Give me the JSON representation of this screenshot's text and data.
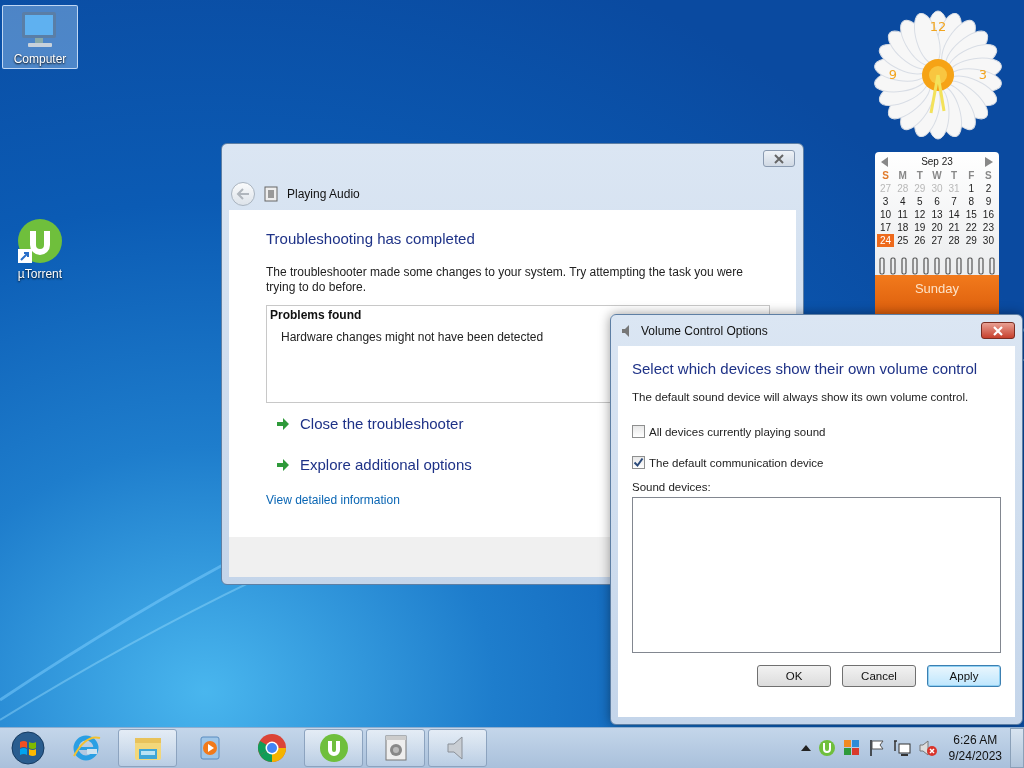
{
  "desktop_icons": [
    {
      "kind": "computer",
      "label": "Computer",
      "selected": true
    },
    {
      "kind": "torrent",
      "label": "µTorrent",
      "selected": false
    }
  ],
  "clock_gadget": {
    "numerals": [
      "12",
      "9",
      "3"
    ]
  },
  "calendar_gadget": {
    "month": "Sep 23",
    "weekdays": [
      {
        "label": "S",
        "current": true
      },
      {
        "label": "M",
        "current": false
      },
      {
        "label": "T",
        "current": false
      },
      {
        "label": "W",
        "current": false
      },
      {
        "label": "T",
        "current": false
      },
      {
        "label": "F",
        "current": false
      },
      {
        "label": "S",
        "current": false
      }
    ],
    "weeks": [
      [
        {
          "day": "27",
          "other_month": true,
          "selected": false
        },
        {
          "day": "28",
          "other_month": true,
          "selected": false
        },
        {
          "day": "29",
          "other_month": true,
          "selected": false
        },
        {
          "day": "30",
          "other_month": true,
          "selected": false
        },
        {
          "day": "31",
          "other_month": true,
          "selected": false
        },
        {
          "day": "1",
          "other_month": false,
          "selected": false
        },
        {
          "day": "2",
          "other_month": false,
          "selected": false
        }
      ],
      [
        {
          "day": "3",
          "other_month": false,
          "selected": false
        },
        {
          "day": "4",
          "other_month": false,
          "selected": false
        },
        {
          "day": "5",
          "other_month": false,
          "selected": false
        },
        {
          "day": "6",
          "other_month": false,
          "selected": false
        },
        {
          "day": "7",
          "other_month": false,
          "selected": false
        },
        {
          "day": "8",
          "other_month": false,
          "selected": false
        },
        {
          "day": "9",
          "other_month": false,
          "selected": false
        }
      ],
      [
        {
          "day": "10",
          "other_month": false,
          "selected": false
        },
        {
          "day": "11",
          "other_month": false,
          "selected": false
        },
        {
          "day": "12",
          "other_month": false,
          "selected": false
        },
        {
          "day": "13",
          "other_month": false,
          "selected": false
        },
        {
          "day": "14",
          "other_month": false,
          "selected": false
        },
        {
          "day": "15",
          "other_month": false,
          "selected": false
        },
        {
          "day": "16",
          "other_month": false,
          "selected": false
        }
      ],
      [
        {
          "day": "17",
          "other_month": false,
          "selected": false
        },
        {
          "day": "18",
          "other_month": false,
          "selected": false
        },
        {
          "day": "19",
          "other_month": false,
          "selected": false
        },
        {
          "day": "20",
          "other_month": false,
          "selected": false
        },
        {
          "day": "21",
          "other_month": false,
          "selected": false
        },
        {
          "day": "22",
          "other_month": false,
          "selected": false
        },
        {
          "day": "23",
          "other_month": false,
          "selected": false
        }
      ],
      [
        {
          "day": "24",
          "other_month": false,
          "selected": true
        },
        {
          "day": "25",
          "other_month": false,
          "selected": false
        },
        {
          "day": "26",
          "other_month": false,
          "selected": false
        },
        {
          "day": "27",
          "other_month": false,
          "selected": false
        },
        {
          "day": "28",
          "other_month": false,
          "selected": false
        },
        {
          "day": "29",
          "other_month": false,
          "selected": false
        },
        {
          "day": "30",
          "other_month": false,
          "selected": false
        }
      ]
    ],
    "day_name": "Sunday"
  },
  "troubleshooter_window": {
    "title": "Playing Audio",
    "heading": "Troubleshooting has completed",
    "description": "The troubleshooter made some changes to your system. Try attempting the task you were trying to do before.",
    "problems": {
      "header": "Problems found",
      "items": [
        "Hardware changes might not have been detected"
      ]
    },
    "actions": [
      "Close the troubleshooter",
      "Explore additional options"
    ],
    "details_link": "View detailed information"
  },
  "volume_dialog": {
    "title": "Volume Control Options",
    "heading": "Select which devices show their own volume control",
    "description": "The default sound device will always show its own volume control.",
    "options": [
      {
        "label": "All devices currently playing sound",
        "checked": false
      },
      {
        "label": "The default communication device",
        "checked": true
      }
    ],
    "list_label": "Sound devices:",
    "buttons": [
      {
        "label": "OK",
        "default": false
      },
      {
        "label": "Cancel",
        "default": false
      },
      {
        "label": "Apply",
        "default": true
      }
    ]
  },
  "taskbar": {
    "buttons": [
      {
        "kind": "ie",
        "open": false
      },
      {
        "kind": "explorer",
        "open": true
      },
      {
        "kind": "media",
        "open": false
      },
      {
        "kind": "chrome",
        "open": false
      },
      {
        "kind": "torrent",
        "open": true
      },
      {
        "kind": "troubleshooter",
        "open": true
      },
      {
        "kind": "speaker",
        "open": true
      }
    ],
    "tray": [
      {
        "kind": "torrent"
      },
      {
        "kind": "apps"
      },
      {
        "kind": "flag"
      },
      {
        "kind": "network"
      },
      {
        "kind": "muted"
      }
    ],
    "time": "6:26 AM",
    "date": "9/24/2023"
  }
}
